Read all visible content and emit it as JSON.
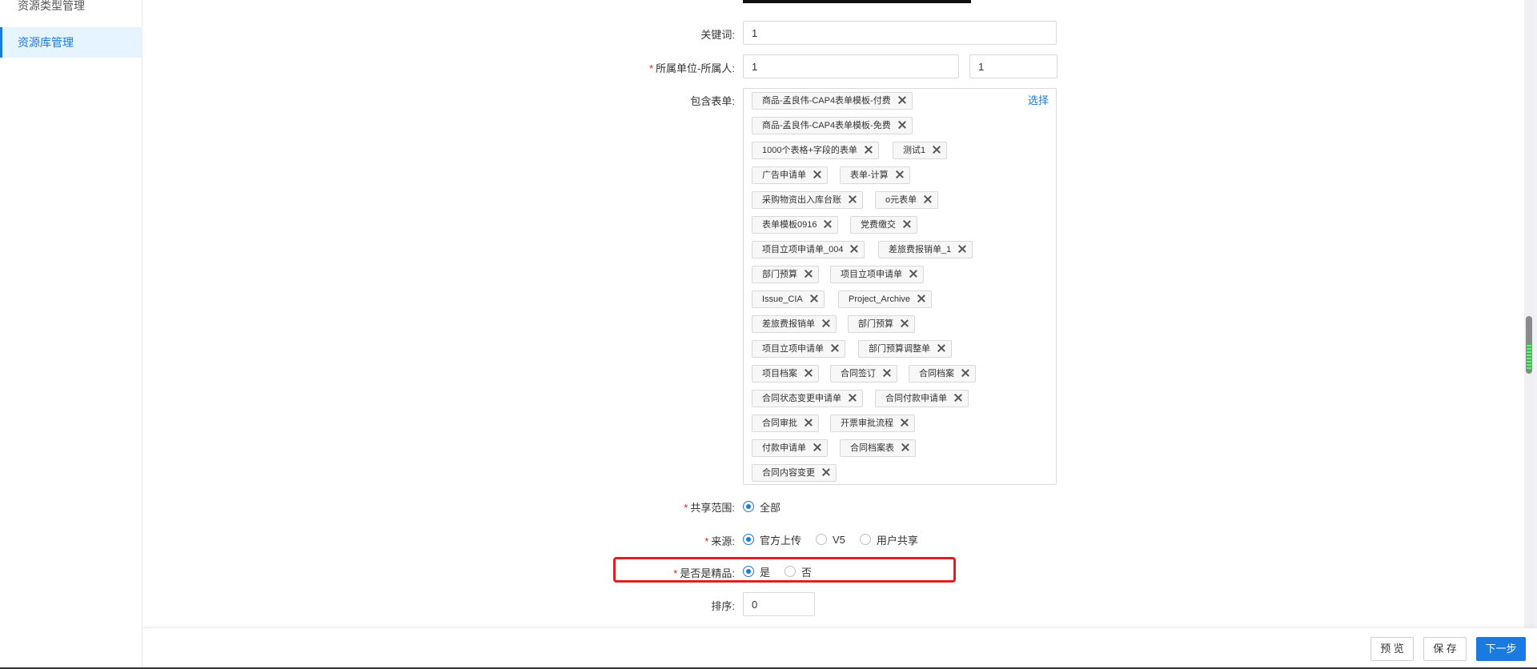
{
  "sidebar": {
    "items": [
      {
        "label": "资源类型管理"
      },
      {
        "label": "资源库管理"
      }
    ]
  },
  "form": {
    "keyword": {
      "label": "关键词",
      "value": "1"
    },
    "owner": {
      "label": "所属单位-所属人",
      "unit_value": "1",
      "person_value": "1"
    },
    "forms": {
      "label": "包含表单",
      "select_label": "选择",
      "tags": [
        "商品-孟良伟-CAP4表单模板-付费",
        "商品-孟良伟-CAP4表单模板-免费",
        "1000个表格+字段的表单",
        "测试1",
        "广告申请单",
        "表单-计算",
        "采购物资出入库台账",
        "o元表单",
        "表单模板0916",
        "党费缴交",
        "项目立项申请单_004",
        "差旅费报销单_1",
        "部门预算",
        "项目立项申请单",
        "Issue_CIA",
        "Project_Archive",
        "差旅费报销单",
        "部门预算",
        "项目立项申请单",
        "部门预算调整单",
        "项目档案",
        "合同签订",
        "合同档案",
        "合同状态变更申请单",
        "合同付款申请单",
        "合同审批",
        "开票审批流程",
        "付款申请单",
        "合同档案表",
        "合同内容变更"
      ]
    },
    "share": {
      "label": "共享范围",
      "options": [
        "全部"
      ],
      "selected": 0
    },
    "source": {
      "label": "来源",
      "options": [
        "官方上传",
        "V5",
        "用户共享"
      ],
      "selected": 0
    },
    "premium": {
      "label": "是否是精品",
      "options": [
        "是",
        "否"
      ],
      "selected": 0
    },
    "order": {
      "label": "排序",
      "value": "0"
    }
  },
  "footer": {
    "preview_label": "预 览",
    "save_label": "保 存",
    "next_label": "下一步"
  },
  "colors": {
    "accent": "#1a7ae0",
    "required": "#e02020",
    "highlight": "#e02020"
  }
}
